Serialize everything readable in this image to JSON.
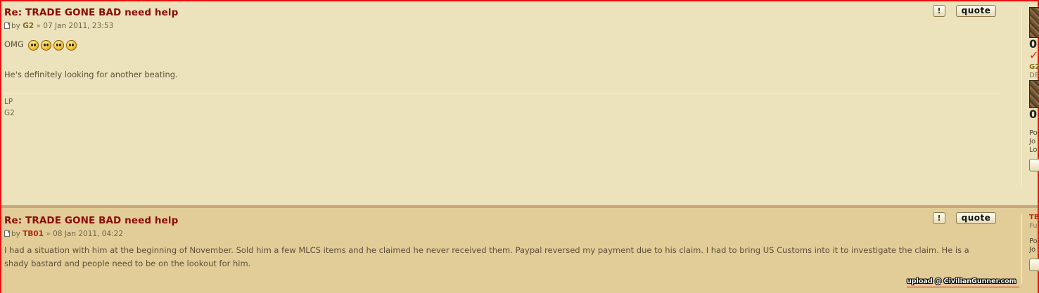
{
  "posts": [
    {
      "title": "Re: TRADE GONE BAD need help",
      "by_label": "by",
      "author": "G2",
      "separator": "»",
      "date": "07 Jan 2011, 23:53",
      "content_lines": [
        "OMG",
        "He's definitely looking for another beating."
      ],
      "smileys": [
        "laughing-smiley-icon",
        "shocked-smiley-icon",
        "rolleyes-smiley-icon",
        "grinning-smiley-icon"
      ],
      "signature": [
        "LP",
        "G2"
      ],
      "report_label": "!",
      "quote_label": "quote",
      "profile": {
        "digit": "0",
        "name": "G2",
        "rank": "DE",
        "digit2": "0",
        "lines": [
          "Po",
          "Jo",
          "Lo"
        ]
      }
    },
    {
      "title": "Re: TRADE GONE BAD need help",
      "by_label": "by",
      "author": "TB01",
      "separator": "»",
      "date": "08 Jan 2011, 04:22",
      "content_lines": [
        "I had a situation with him at the beginning of November. Sold him a few MLCS items and he claimed he never received them. Paypal reversed my payment due to his claim. I had to bring US Customs into it to investigate the claim. He is a",
        "shady bastard and people need to be on the lookout for him."
      ],
      "report_label": "!",
      "quote_label": "quote",
      "profile": {
        "name": "TB",
        "rank": "Fu",
        "lines": [
          "Po",
          "Jo"
        ]
      }
    }
  ],
  "watermark": "upload @ CivilianGunner.com",
  "colors": {
    "post_bg_1": "#ece2bb",
    "post_bg_2": "#e2cd98",
    "title": "#8a0b06",
    "border": "#e8120f"
  }
}
